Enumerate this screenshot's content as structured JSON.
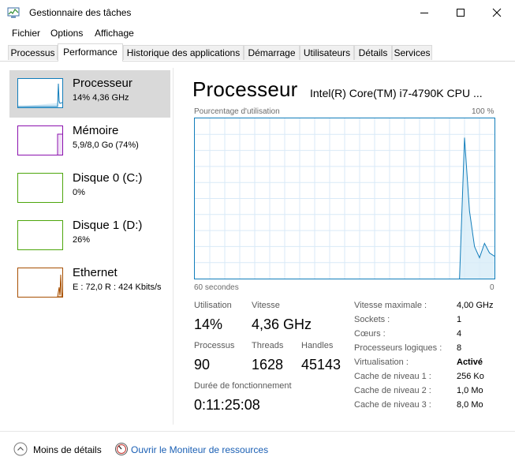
{
  "window": {
    "title": "Gestionnaire des tâches",
    "icon": "task-manager-icon"
  },
  "menu": [
    "Fichier",
    "Options",
    "Affichage"
  ],
  "tabs": [
    {
      "label": "Processus",
      "active": false
    },
    {
      "label": "Performance",
      "active": true
    },
    {
      "label": "Historique des applications",
      "active": false
    },
    {
      "label": "Démarrage",
      "active": false
    },
    {
      "label": "Utilisateurs",
      "active": false
    },
    {
      "label": "Détails",
      "active": false
    },
    {
      "label": "Services",
      "active": false
    }
  ],
  "resources": [
    {
      "name": "Processeur",
      "detail": "14% 4,36 GHz",
      "selected": true,
      "color": "#117dbb"
    },
    {
      "name": "Mémoire",
      "detail": "5,9/8,0 Go (74%)",
      "selected": false,
      "color": "#8b12ae"
    },
    {
      "name": "Disque 0 (C:)",
      "detail": "0%",
      "selected": false,
      "color": "#4da60c"
    },
    {
      "name": "Disque 1 (D:)",
      "detail": "26%",
      "selected": false,
      "color": "#4da60c"
    },
    {
      "name": "Ethernet",
      "detail": "E : 72,0 R : 424 Kbits/s",
      "selected": false,
      "color": "#a74f01"
    }
  ],
  "main": {
    "title": "Processeur",
    "cpu_model": "Intel(R) Core(TM) i7-4790K CPU ...",
    "graph_label_left": "Pourcentage d'utilisation",
    "graph_label_right": "100 %",
    "axis_left": "60 secondes",
    "axis_right": "0",
    "graph_color": "#117dbb"
  },
  "stats": {
    "utilisation_label": "Utilisation",
    "utilisation_value": "14%",
    "vitesse_label": "Vitesse",
    "vitesse_value": "4,36 GHz",
    "processus_label": "Processus",
    "processus_value": "90",
    "threads_label": "Threads",
    "threads_value": "1628",
    "handles_label": "Handles",
    "handles_value": "45143",
    "uptime_label": "Durée de fonctionnement",
    "uptime_value": "0:11:25:08"
  },
  "specs": [
    {
      "label": "Vitesse maximale :",
      "value": "4,00 GHz",
      "bold": false
    },
    {
      "label": "Sockets :",
      "value": "1",
      "bold": false
    },
    {
      "label": "Cœurs :",
      "value": "4",
      "bold": false
    },
    {
      "label": "Processeurs logiques :",
      "value": "8",
      "bold": false
    },
    {
      "label": "Virtualisation :",
      "value": "Activé",
      "bold": true
    },
    {
      "label": "Cache de niveau 1 :",
      "value": "256 Ko",
      "bold": false
    },
    {
      "label": "Cache de niveau 2 :",
      "value": "1,0 Mo",
      "bold": false
    },
    {
      "label": "Cache de niveau 3 :",
      "value": "8,0 Mo",
      "bold": false
    }
  ],
  "chart_data": {
    "type": "area",
    "x": [
      0,
      1,
      2,
      3,
      4,
      5,
      6,
      7,
      8,
      9,
      10,
      11,
      12,
      13,
      14,
      15,
      16,
      17,
      18,
      19,
      20,
      21,
      22,
      23,
      24,
      25,
      26,
      27,
      28,
      29,
      30,
      31,
      32,
      33,
      34,
      35,
      36,
      37,
      38,
      39,
      40,
      41,
      42,
      43,
      44,
      45,
      46,
      47,
      48,
      49,
      50,
      51,
      52,
      53,
      54,
      55,
      56,
      57,
      58,
      59,
      60
    ],
    "values": [
      0,
      0,
      0,
      0,
      0,
      0,
      0,
      0,
      0,
      0,
      0,
      0,
      0,
      0,
      0,
      0,
      0,
      0,
      0,
      0,
      0,
      0,
      0,
      0,
      0,
      0,
      0,
      0,
      0,
      0,
      0,
      0,
      0,
      0,
      0,
      0,
      0,
      0,
      0,
      0,
      0,
      0,
      0,
      0,
      0,
      0,
      0,
      0,
      0,
      0,
      0,
      0,
      0,
      0,
      88,
      42,
      20,
      13,
      22,
      16,
      14
    ],
    "ylim": [
      0,
      100
    ],
    "grid": true
  },
  "footer": {
    "less_details": "Moins de détails",
    "resource_monitor": "Ouvrir le Moniteur de ressources"
  }
}
